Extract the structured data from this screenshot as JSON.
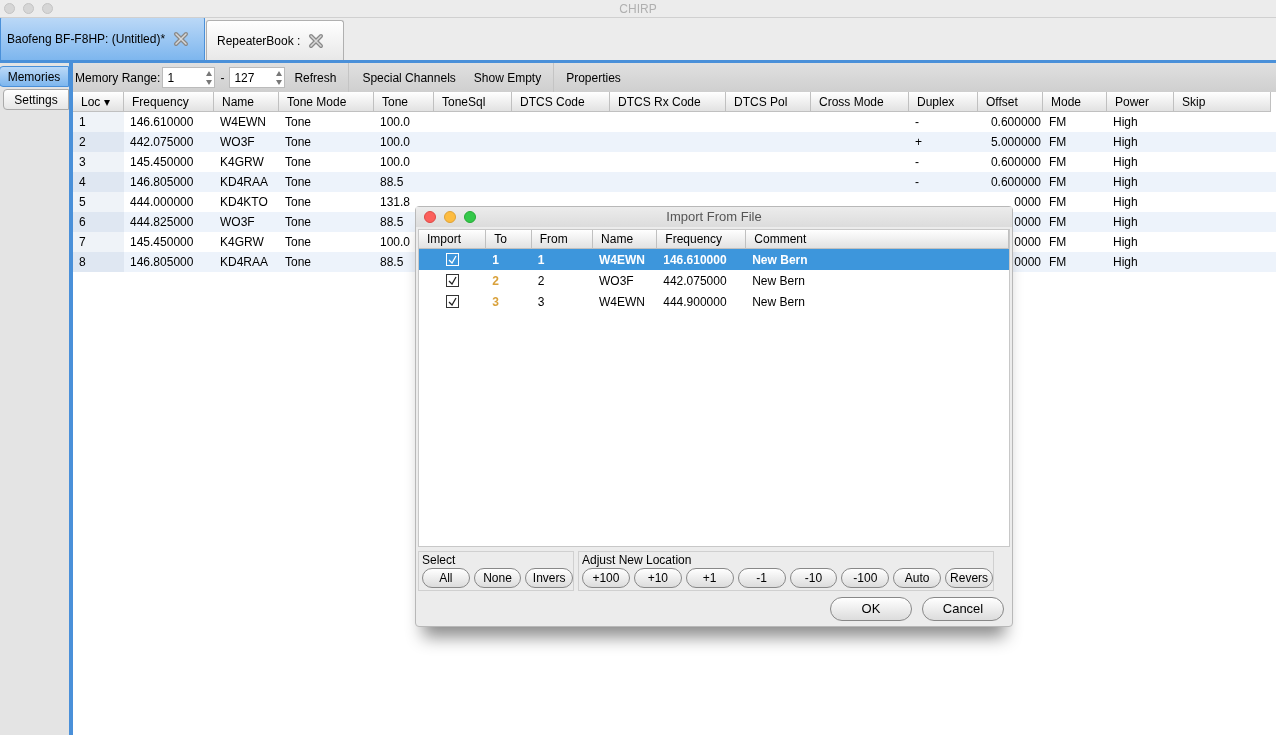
{
  "window": {
    "title": "CHIRP"
  },
  "tabs": [
    {
      "label": "Baofeng BF-F8HP: (Untitled)*",
      "selected": true
    },
    {
      "label": "RepeaterBook :",
      "selected": false
    }
  ],
  "side_tabs": [
    {
      "label": "Memories",
      "selected": true
    },
    {
      "label": "Settings",
      "selected": false
    }
  ],
  "toolbar": {
    "range_label": "Memory Range:",
    "range_start": "1",
    "range_sep": "-",
    "range_end": "127",
    "buttons": [
      "Refresh",
      "Special Channels",
      "Show Empty",
      "Properties"
    ]
  },
  "table": {
    "columns": [
      "Loc ▾",
      "Frequency",
      "Name",
      "Tone Mode",
      "Tone",
      "ToneSql",
      "DTCS Code",
      "DTCS Rx Code",
      "DTCS Pol",
      "Cross Mode",
      "Duplex",
      "Offset",
      "Mode",
      "Power",
      "Skip"
    ],
    "rows": [
      {
        "cells": [
          "1",
          "146.610000",
          "W4EWN",
          "Tone",
          "100.0",
          "",
          "",
          "",
          "",
          "",
          "-",
          "0.600000",
          "FM",
          "High",
          ""
        ]
      },
      {
        "cells": [
          "2",
          "442.075000",
          "WO3F",
          "Tone",
          "100.0",
          "",
          "",
          "",
          "",
          "",
          "+",
          "5.000000",
          "FM",
          "High",
          ""
        ]
      },
      {
        "cells": [
          "3",
          "145.450000",
          "K4GRW",
          "Tone",
          "100.0",
          "",
          "",
          "",
          "",
          "",
          "-",
          "0.600000",
          "FM",
          "High",
          ""
        ]
      },
      {
        "cells": [
          "4",
          "146.805000",
          "KD4RAA",
          "Tone",
          "88.5",
          "",
          "",
          "",
          "",
          "",
          "-",
          "0.600000",
          "FM",
          "High",
          ""
        ]
      },
      {
        "cells": [
          "5",
          "444.000000",
          "KD4KTO",
          "Tone",
          "131.8",
          "",
          "",
          "",
          "",
          "",
          "",
          "0000",
          "FM",
          "High",
          ""
        ]
      },
      {
        "cells": [
          "6",
          "444.825000",
          "WO3F",
          "Tone",
          "88.5",
          "",
          "",
          "",
          "",
          "",
          "",
          "0000",
          "FM",
          "High",
          ""
        ]
      },
      {
        "cells": [
          "7",
          "145.450000",
          "K4GRW",
          "Tone",
          "100.0",
          "",
          "",
          "",
          "",
          "",
          "",
          "0000",
          "FM",
          "High",
          ""
        ]
      },
      {
        "cells": [
          "8",
          "146.805000",
          "KD4RAA",
          "Tone",
          "88.5",
          "",
          "",
          "",
          "",
          "",
          "",
          "0000",
          "FM",
          "High",
          ""
        ]
      }
    ]
  },
  "dialog": {
    "title": "Import From File",
    "columns": [
      "Import",
      "To",
      "From",
      "Name",
      "Frequency",
      "Comment"
    ],
    "rows": [
      {
        "checked": true,
        "selected": true,
        "to": "1",
        "from": "1",
        "name": "W4EWN",
        "frequency": "146.610000",
        "comment": "New Bern"
      },
      {
        "checked": true,
        "selected": false,
        "to": "2",
        "from": "2",
        "name": "WO3F",
        "frequency": "442.075000",
        "comment": "New Bern"
      },
      {
        "checked": true,
        "selected": false,
        "to": "3",
        "from": "3",
        "name": "W4EWN",
        "frequency": "444.900000",
        "comment": "New Bern"
      }
    ],
    "select_group": {
      "label": "Select",
      "buttons": [
        "All",
        "None",
        "Invers"
      ]
    },
    "adjust_group": {
      "label": "Adjust New Location",
      "buttons": [
        "+100",
        "+10",
        "+1",
        "-1",
        "-10",
        "-100",
        "Auto",
        "Revers"
      ]
    },
    "buttons": [
      "OK",
      "Cancel"
    ]
  }
}
